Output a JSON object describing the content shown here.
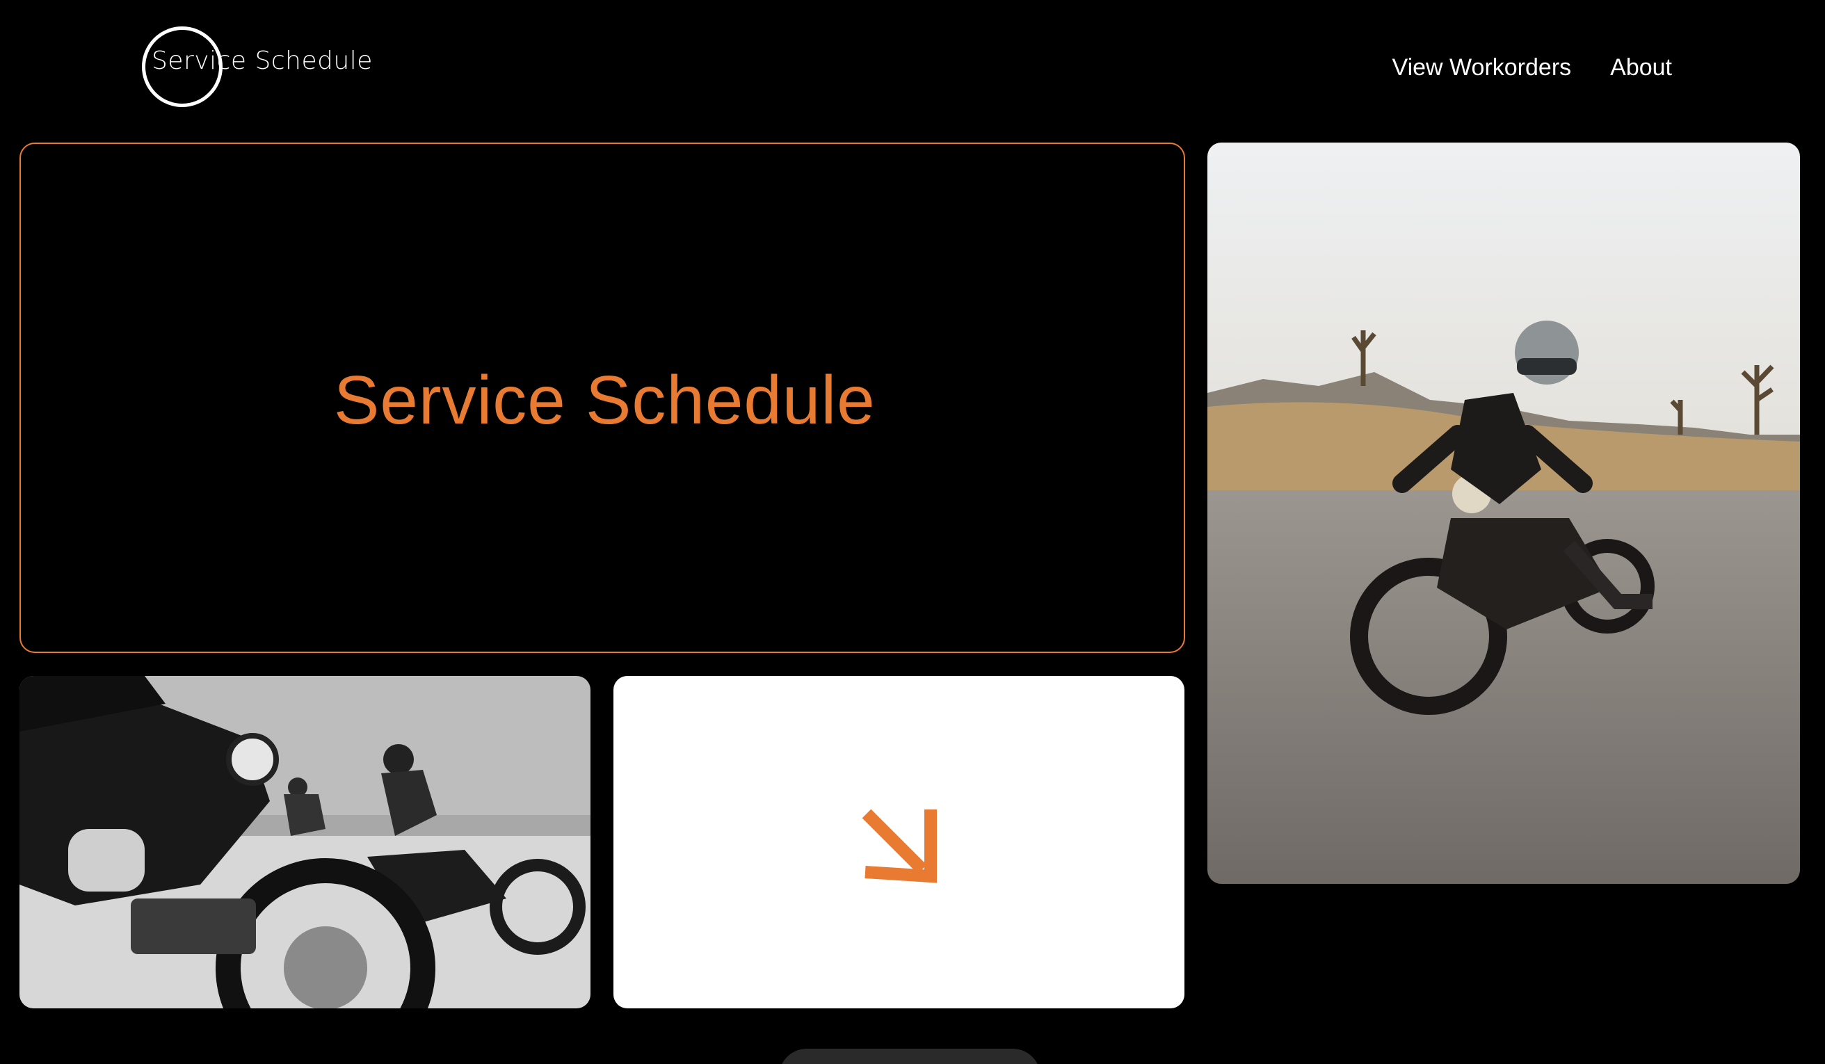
{
  "header": {
    "logo_text": "Service Schedule",
    "nav": [
      {
        "label": "View Workorders"
      },
      {
        "label": "About"
      }
    ]
  },
  "hero": {
    "title": "Service Schedule"
  },
  "tiles": {
    "bw_photo": "motorcycle-riders-photo",
    "desert_photo": "desert-motorcycle-rider-photo",
    "arrow_icon": "arrow-down-right-icon"
  },
  "colors": {
    "accent": "#e87a32",
    "background": "#000000",
    "card": "#ffffff"
  },
  "bottom": {
    "button_label": ""
  }
}
